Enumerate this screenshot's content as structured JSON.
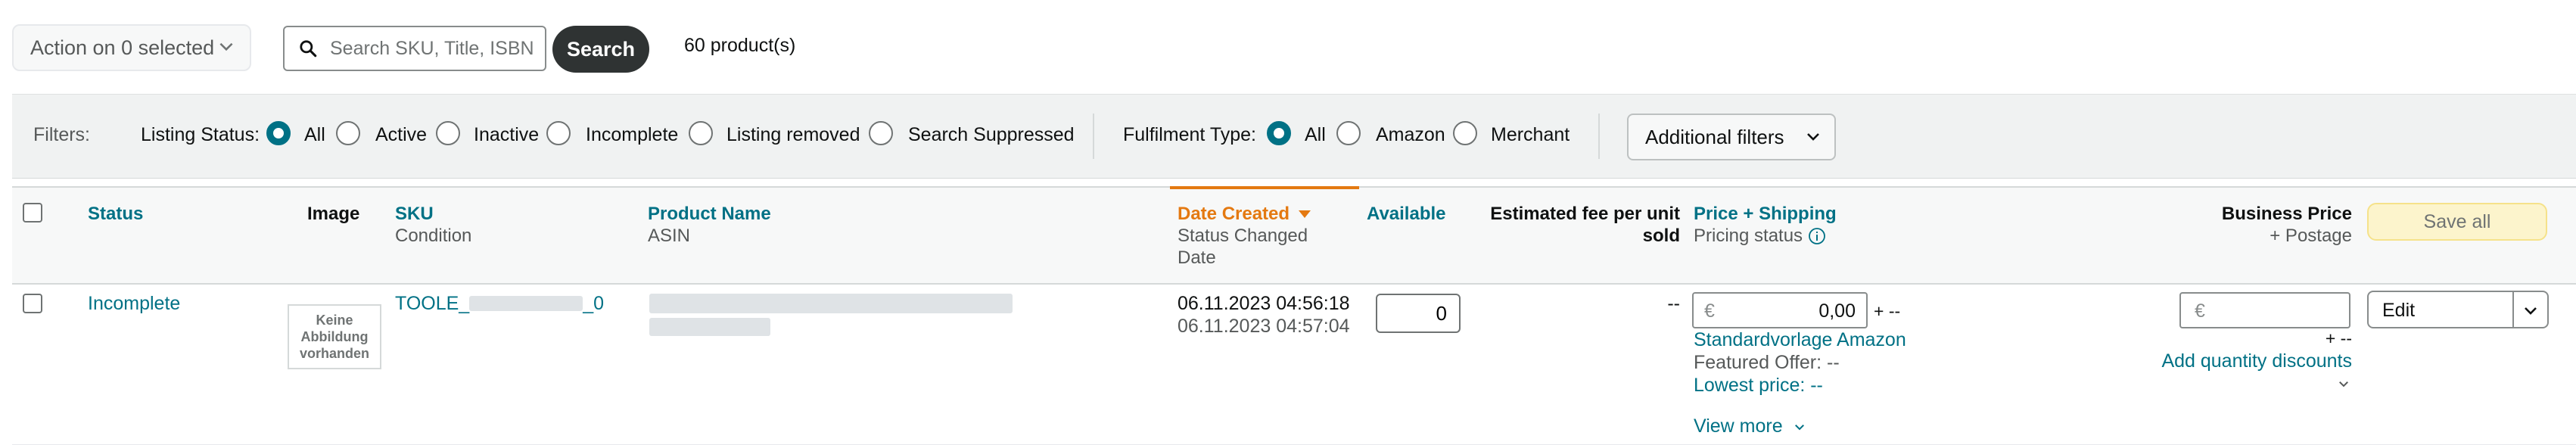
{
  "toolbar": {
    "action_label": "Action on 0 selected",
    "search_placeholder": "Search SKU, Title, ISBN",
    "search_button": "Search",
    "product_count": "60 product(s)"
  },
  "filters": {
    "label": "Filters:",
    "listing_status": {
      "label": "Listing Status:",
      "options": [
        "All",
        "Active",
        "Inactive",
        "Incomplete",
        "Listing removed",
        "Search Suppressed"
      ],
      "selected": "All"
    },
    "fulfilment_type": {
      "label": "Fulfilment Type:",
      "options": [
        "All",
        "Amazon",
        "Merchant"
      ],
      "selected": "All"
    },
    "additional_filters": "Additional filters"
  },
  "table": {
    "headers": {
      "status": "Status",
      "image": "Image",
      "sku": "SKU",
      "sku_sub": "Condition",
      "product_name": "Product Name",
      "product_name_sub": "ASIN",
      "date_created": "Date Created",
      "date_created_sub1": "Status Changed",
      "date_created_sub2": "Date",
      "available": "Available",
      "fee_line1": "Estimated fee per unit",
      "fee_line2": "sold",
      "price": "Price + Shipping",
      "price_sub": "Pricing status",
      "business_price": "Business Price",
      "business_price_sub": "+ Postage",
      "save_all": "Save all"
    },
    "rows": [
      {
        "status": "Incomplete",
        "image_text": "Keine Abbildung vorhanden",
        "sku_prefix": "TOOLE_",
        "sku_suffix": "_0",
        "date_created": "06.11.2023 04:56:18",
        "status_changed": "06.11.2023 04:57:04",
        "available": "0",
        "fee": "--",
        "currency": "€",
        "price": "0,00",
        "shipping": "+ --",
        "template": "Standardvorlage Amazon",
        "featured_offer": "Featured Offer: --",
        "lowest_price": "Lowest price: --",
        "view_more": "View more",
        "business_currency": "€",
        "business_postage": "+ --",
        "quantity_discounts": "Add quantity discounts",
        "edit": "Edit"
      }
    ]
  },
  "colors": {
    "link": "#007185",
    "sort_accent": "#e47911",
    "radio_selected": "#007185",
    "search_button": "#2f3333",
    "save_all_bg": "#fcf4cc"
  }
}
